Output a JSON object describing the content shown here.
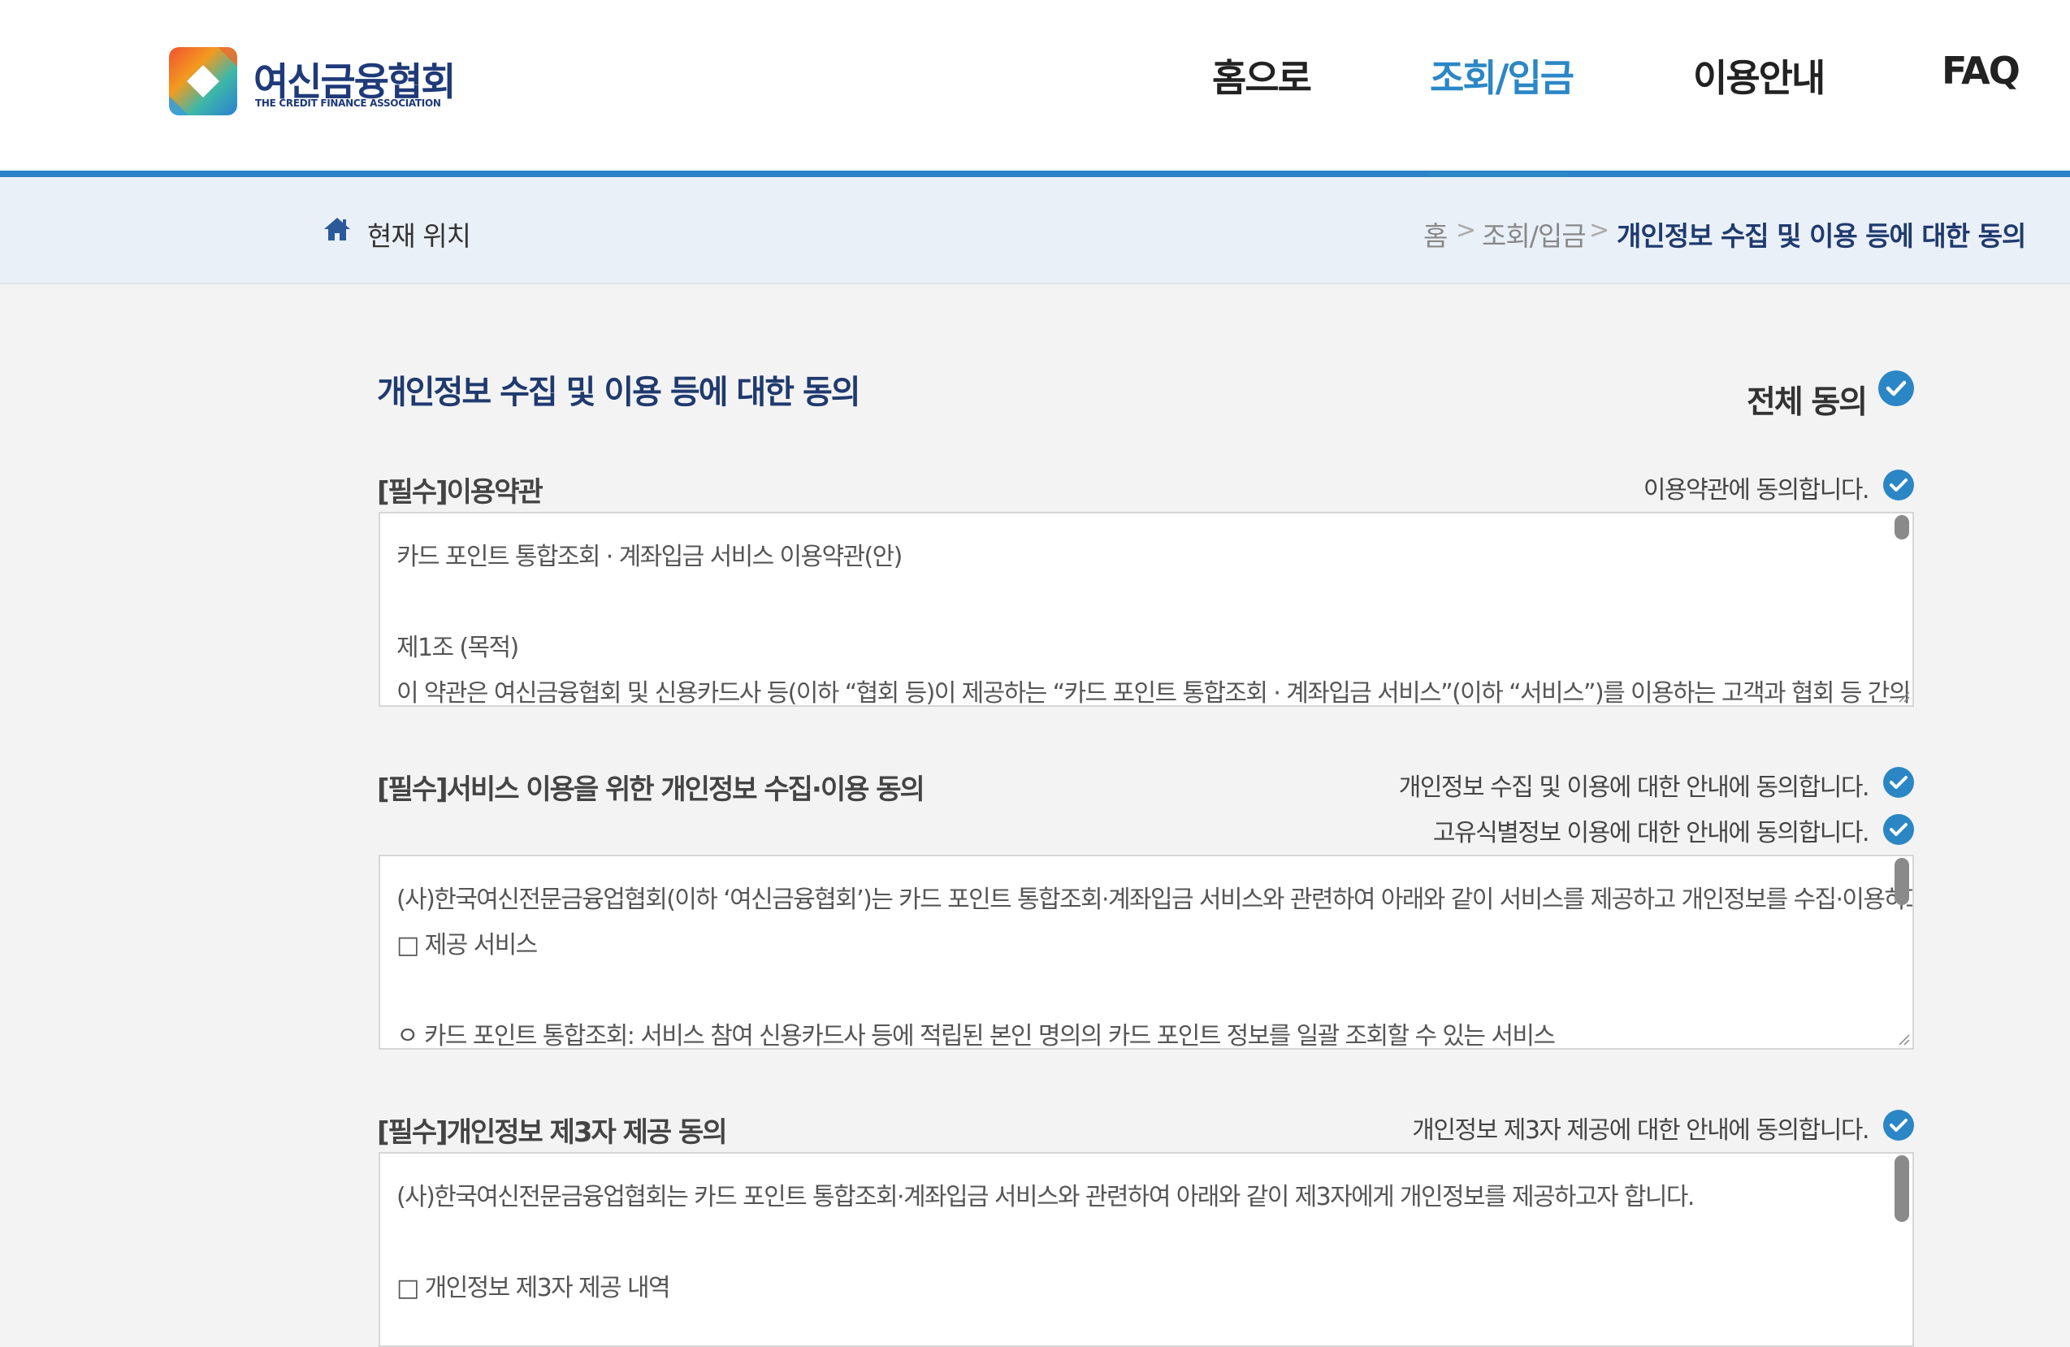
{
  "header": {
    "logo_text": "여신금융협회",
    "logo_subtext": "THE CREDIT FINANCE ASSOCIATION",
    "nav": [
      {
        "label": "홈으로"
      },
      {
        "label": "조회/입금"
      },
      {
        "label": "이용안내"
      },
      {
        "label": "FAQ"
      }
    ],
    "active_nav": "조회/입금"
  },
  "breadcrumb": {
    "location_label": "현재 위치",
    "items": [
      "홈",
      "조회/입금",
      "개인정보 수집 및 이용 등에 대한 동의"
    ],
    "separator": ">"
  },
  "main": {
    "title": "개인정보 수집 및 이용 등에 대한 동의",
    "agree_all_label": "전체 동의",
    "sections": [
      {
        "title": "[필수]이용약관",
        "agreements": [
          "이용약관에 동의합니다."
        ],
        "content": [
          "카드 포인트 통합조회 · 계좌입금 서비스 이용약관(안)",
          "",
          "제1조 (목적)",
          "이 약관은 여신금융협회 및 신용카드사 등(이하 “협회 등)이 제공하는 “카드 포인트 통합조회 · 계좌입금 서비스”(이하 “서비스”)를 이용하는 고객과 협회 등 간의 서비스 이용에"
        ]
      },
      {
        "title": "[필수]서비스 이용을 위한 개인정보 수집·이용 동의",
        "agreements": [
          "개인정보 수집 및 이용에 대한 안내에 동의합니다.",
          "고유식별정보 이용에 대한 안내에 동의합니다."
        ],
        "content": [
          "(사)한국여신전문금융업협회(이하 ‘여신금융협회’)는 카드 포인트 통합조회·계좌입금 서비스와 관련하여 아래와 같이 서비스를 제공하고 개인정보를 수집·이용하고자 합니다.",
          "□ 제공 서비스",
          "",
          " ㅇ 카드 포인트 통합조회: 서비스 참여 신용카드사 등에 적립된 본인 명의의 카드 포인트 정보를 일괄 조회할 수 있는 서비스"
        ]
      },
      {
        "title": "[필수]개인정보 제3자 제공 동의",
        "agreements": [
          "개인정보 제3자 제공에 대한 안내에 동의합니다."
        ],
        "content": [
          "(사)한국여신전문금융업협회는 카드 포인트 통합조회·계좌입금 서비스와 관련하여 아래와 같이 제3자에게 개인정보를 제공하고자 합니다.",
          "",
          "□ 개인정보 제3자 제공 내역"
        ]
      }
    ]
  },
  "colors": {
    "accent": "#2b86c5",
    "title_navy": "#1f3a6e",
    "breadcrumb_bg": "#eaf0f7",
    "page_bg": "#f3f3f3"
  },
  "icons": [
    "home-icon",
    "check-circle-icon",
    "logo-mark-icon"
  ]
}
